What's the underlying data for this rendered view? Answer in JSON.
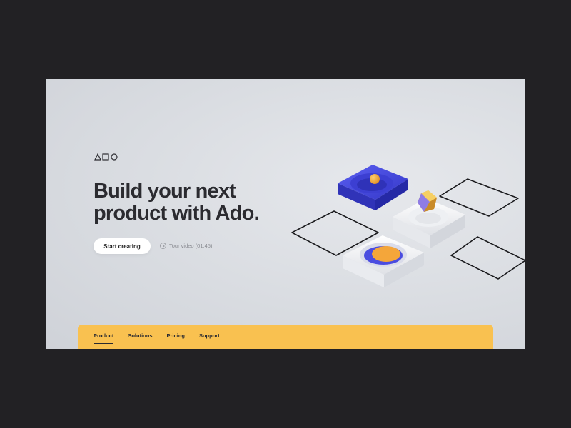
{
  "brand": {
    "name": "Ado",
    "logo_icon": "triangle-square-circle-logo"
  },
  "hero": {
    "headline_line1": "Build your next",
    "headline_line2": "product with Ado.",
    "cta_label": "Start creating",
    "tour_label": "Tour video (01:45)",
    "tour_icon": "play-circle-icon"
  },
  "nav": {
    "items": [
      {
        "label": "Product",
        "active": true
      },
      {
        "label": "Solutions",
        "active": false
      },
      {
        "label": "Pricing",
        "active": false
      },
      {
        "label": "Support",
        "active": false
      }
    ]
  },
  "colors": {
    "page_background": "#222124",
    "hero_background": "#dcdfe3",
    "nav_background": "#f9c150",
    "accent_blue": "#4a4ce0",
    "accent_orange": "#f4a63a",
    "text_dark": "#2b2b30"
  }
}
